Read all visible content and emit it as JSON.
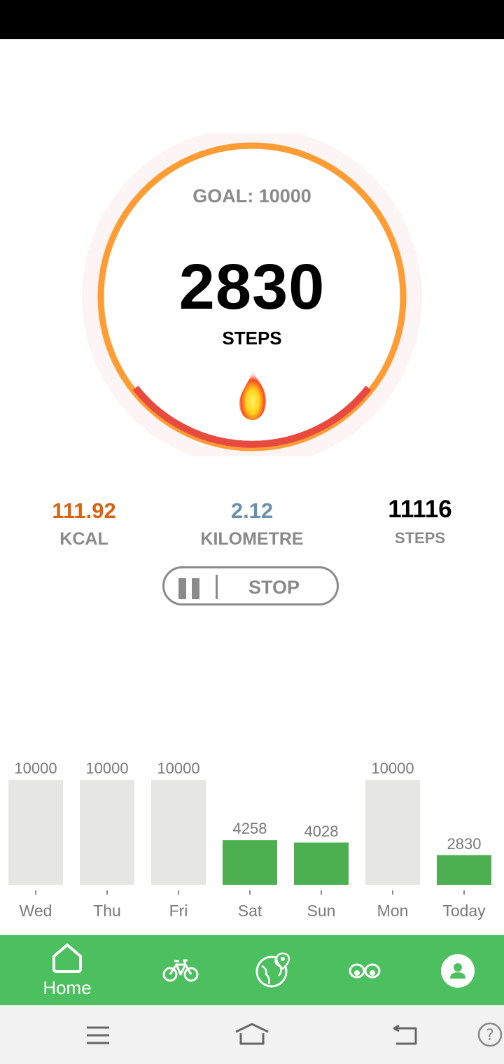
{
  "goal": {
    "label": "GOAL: 10000"
  },
  "today": {
    "steps": "2830",
    "steps_label": "STEPS",
    "progress": 0.283
  },
  "stats": [
    {
      "value": "111.92",
      "label": "KCAL",
      "color": "#d9620f"
    },
    {
      "value": "2.12",
      "label": "KILOMETRE",
      "color": "#6b8fb0"
    },
    {
      "value": "11116",
      "label": "STEPS",
      "color": "#000000"
    }
  ],
  "controls": {
    "stop_label": "STOP"
  },
  "chart_data": {
    "type": "bar",
    "categories": [
      "Wed",
      "Thu",
      "Fri",
      "Sat",
      "Sun",
      "Mon",
      "Today"
    ],
    "values": [
      10000,
      10000,
      10000,
      4258,
      4028,
      10000,
      2830
    ],
    "value_labels": [
      "10000",
      "10000",
      "10000",
      "4258",
      "4028",
      "10000",
      "2830"
    ],
    "goal": 10000,
    "colors": {
      "goal_met": "#e6e6e4",
      "below_goal": "#4caf50"
    }
  },
  "bottom_nav": {
    "home_label": "Home"
  },
  "colors": {
    "accent": "#4cbf5f",
    "ring_orange": "#ff9c33",
    "ring_red": "#e84a3f"
  }
}
